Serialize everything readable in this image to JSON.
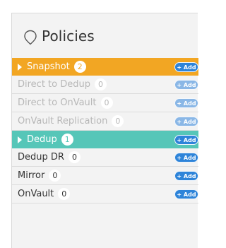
{
  "panel": {
    "title": "Policies",
    "title_icon": "location-pin-outline-icon"
  },
  "colors": {
    "snapshot": "#f2a623",
    "dedup": "#56c6b8",
    "add_button": "#2e84d9",
    "add_button_dim": "#8ab7e6"
  },
  "add_label": "+ Add",
  "groups": [
    {
      "name": "Snapshot",
      "count": "2",
      "items": [
        {
          "name": "Direct to Dedup",
          "count": "0"
        },
        {
          "name": "Direct to OnVault",
          "count": "0"
        },
        {
          "name": "OnVault Replication",
          "count": "0"
        }
      ]
    },
    {
      "name": "Dedup",
      "count": "1",
      "items": [
        {
          "name": "Dedup DR",
          "count": "0"
        },
        {
          "name": "Mirror",
          "count": "0"
        },
        {
          "name": "OnVault",
          "count": "0"
        }
      ]
    }
  ]
}
